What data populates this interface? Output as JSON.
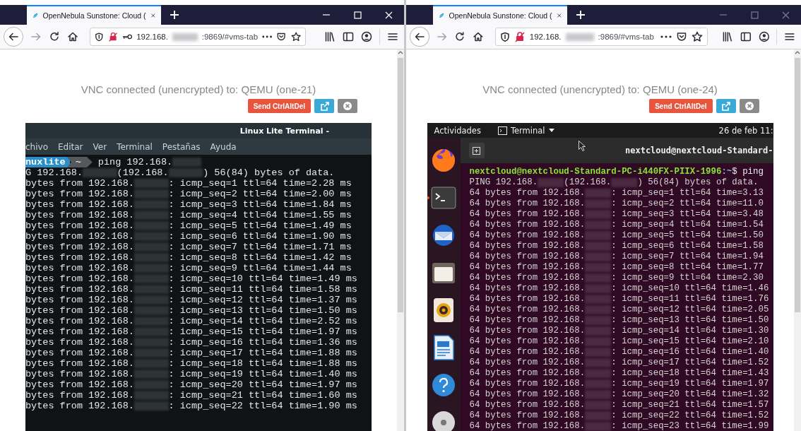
{
  "windows": [
    {
      "active": true,
      "tab_title": "OpenNebula Sunstone: Cloud (",
      "url_parts": [
        "192.168.",
        ":9869/#vms-tab"
      ],
      "insecure_key": true,
      "vnc_status": "VNC connected (unencrypted) to: QEMU (one-21)",
      "send_button": "Send CtrlAltDel",
      "screen": {
        "kind": "xfce",
        "title": "Linux Lite Terminal -",
        "menu": [
          "chivo",
          "Editar",
          "Ver",
          "Terminal",
          "Pestañas",
          "Ayuda"
        ],
        "prompt": {
          "host": "nuxlite",
          "path": "~",
          "command": "ping 192.168."
        },
        "lines": [
          [
            "G 192.168.",
            "(192.168.",
            ") 56(84) bytes of data."
          ],
          [
            "bytes from 192.168.",
            ": icmp_seq=1 ttl=64 time=2.28 ms"
          ],
          [
            "bytes from 192.168.",
            ": icmp_seq=2 ttl=64 time=2.00 ms"
          ],
          [
            "bytes from 192.168.",
            ": icmp_seq=3 ttl=64 time=1.84 ms"
          ],
          [
            "bytes from 192.168.",
            ": icmp_seq=4 ttl=64 time=1.55 ms"
          ],
          [
            "bytes from 192.168.",
            ": icmp_seq=5 ttl=64 time=1.49 ms"
          ],
          [
            "bytes from 192.168.",
            ": icmp_seq=6 ttl=64 time=1.90 ms"
          ],
          [
            "bytes from 192.168.",
            ": icmp_seq=7 ttl=64 time=1.71 ms"
          ],
          [
            "bytes from 192.168.",
            ": icmp_seq=8 ttl=64 time=1.42 ms"
          ],
          [
            "bytes from 192.168.",
            ": icmp_seq=9 ttl=64 time=1.44 ms"
          ],
          [
            "bytes from 192.168.",
            ": icmp_seq=10 ttl=64 time=1.49 ms"
          ],
          [
            "bytes from 192.168.",
            ": icmp_seq=11 ttl=64 time=1.58 ms"
          ],
          [
            "bytes from 192.168.",
            ": icmp_seq=12 ttl=64 time=1.37 ms"
          ],
          [
            "bytes from 192.168.",
            ": icmp_seq=13 ttl=64 time=1.50 ms"
          ],
          [
            "bytes from 192.168.",
            ": icmp_seq=14 ttl=64 time=2.52 ms"
          ],
          [
            "bytes from 192.168.",
            ": icmp_seq=15 ttl=64 time=1.97 ms"
          ],
          [
            "bytes from 192.168.",
            ": icmp_seq=16 ttl=64 time=1.36 ms"
          ],
          [
            "bytes from 192.168.",
            ": icmp_seq=17 ttl=64 time=1.88 ms"
          ],
          [
            "bytes from 192.168.",
            ": icmp_seq=18 ttl=64 time=1.88 ms"
          ],
          [
            "bytes from 192.168.",
            ": icmp_seq=19 ttl=64 time=1.40 ms"
          ],
          [
            "bytes from 192.168.",
            ": icmp_seq=20 ttl=64 time=1.97 ms"
          ],
          [
            "bytes from 192.168.",
            ": icmp_seq=21 ttl=64 time=1.60 ms"
          ],
          [
            "bytes from 192.168.",
            ": icmp_seq=22 ttl=64 time=1.90 ms"
          ]
        ]
      }
    },
    {
      "active": false,
      "tab_title": "OpenNebula Sunstone: Cloud (",
      "url_parts": [
        "192.168.",
        ":9869/#vms-tab"
      ],
      "insecure_key": false,
      "vnc_status": "VNC connected (unencrypted) to: QEMU (one-24)",
      "send_button": "Send CtrlAltDel",
      "screen": {
        "kind": "gnome",
        "activities": "Actividades",
        "app_menu": "Terminal",
        "clock": "26 de feb 11:",
        "window_title": "nextcloud@nextcloud-Standard-",
        "dock": [
          {
            "kind": "browser",
            "running": false
          },
          {
            "kind": "terminal",
            "running": true
          },
          {
            "kind": "mail",
            "running": false
          },
          {
            "kind": "folder",
            "running": false
          },
          {
            "kind": "speaker",
            "running": false
          },
          {
            "kind": "document",
            "running": false
          },
          {
            "kind": "help",
            "running": false
          },
          {
            "kind": "disc",
            "running": false
          }
        ],
        "prompt": {
          "user_host": "nextcloud@nextcloud-Standard-PC-i440FX-PIIX-1996",
          "path": ":~",
          "command": "$ ping"
        },
        "lines": [
          [
            "PING 192.168.",
            "(192.168.",
            ") 56(84) bytes of data."
          ],
          [
            "64 bytes from 192.168.",
            ": icmp_seq=1 ttl=64 time=3.13"
          ],
          [
            "64 bytes from 192.168.",
            ": icmp_seq=2 ttl=64 time=11.0"
          ],
          [
            "64 bytes from 192.168.",
            ": icmp_seq=3 ttl=64 time=3.48"
          ],
          [
            "64 bytes from 192.168.",
            ": icmp_seq=4 ttl=64 time=1.54"
          ],
          [
            "64 bytes from 192.168.",
            ": icmp_seq=5 ttl=64 time=1.50"
          ],
          [
            "64 bytes from 192.168.",
            ": icmp_seq=6 ttl=64 time=1.58"
          ],
          [
            "64 bytes from 192.168.",
            ": icmp_seq=7 ttl=64 time=1.94"
          ],
          [
            "64 bytes from 192.168.",
            ": icmp_seq=8 ttl=64 time=1.77"
          ],
          [
            "64 bytes from 192.168.",
            ": icmp_seq=9 ttl=64 time=2.30"
          ],
          [
            "64 bytes from 192.168.",
            ": icmp_seq=10 ttl=64 time=1.46"
          ],
          [
            "64 bytes from 192.168.",
            ": icmp_seq=11 ttl=64 time=1.76"
          ],
          [
            "64 bytes from 192.168.",
            ": icmp_seq=12 ttl=64 time=2.05"
          ],
          [
            "64 bytes from 192.168.",
            ": icmp_seq=13 ttl=64 time=1.50"
          ],
          [
            "64 bytes from 192.168.",
            ": icmp_seq=14 ttl=64 time=1.30"
          ],
          [
            "64 bytes from 192.168.",
            ": icmp_seq=15 ttl=64 time=2.10"
          ],
          [
            "64 bytes from 192.168.",
            ": icmp_seq=16 ttl=64 time=1.40"
          ],
          [
            "64 bytes from 192.168.",
            ": icmp_seq=17 ttl=64 time=1.52"
          ],
          [
            "64 bytes from 192.168.",
            ": icmp_seq=18 ttl=64 time=1.43"
          ],
          [
            "64 bytes from 192.168.",
            ": icmp_seq=19 ttl=64 time=1.97"
          ],
          [
            "64 bytes from 192.168.",
            ": icmp_seq=20 ttl=64 time=1.32"
          ],
          [
            "64 bytes from 192.168.",
            ": icmp_seq=21 ttl=64 time=1.57"
          ],
          [
            "64 bytes from 192.168.",
            ": icmp_seq=22 ttl=64 time=1.52"
          ],
          [
            "64 bytes from 192.168.",
            ": icmp_seq=23 ttl=64 time=1.99"
          ]
        ]
      }
    }
  ]
}
